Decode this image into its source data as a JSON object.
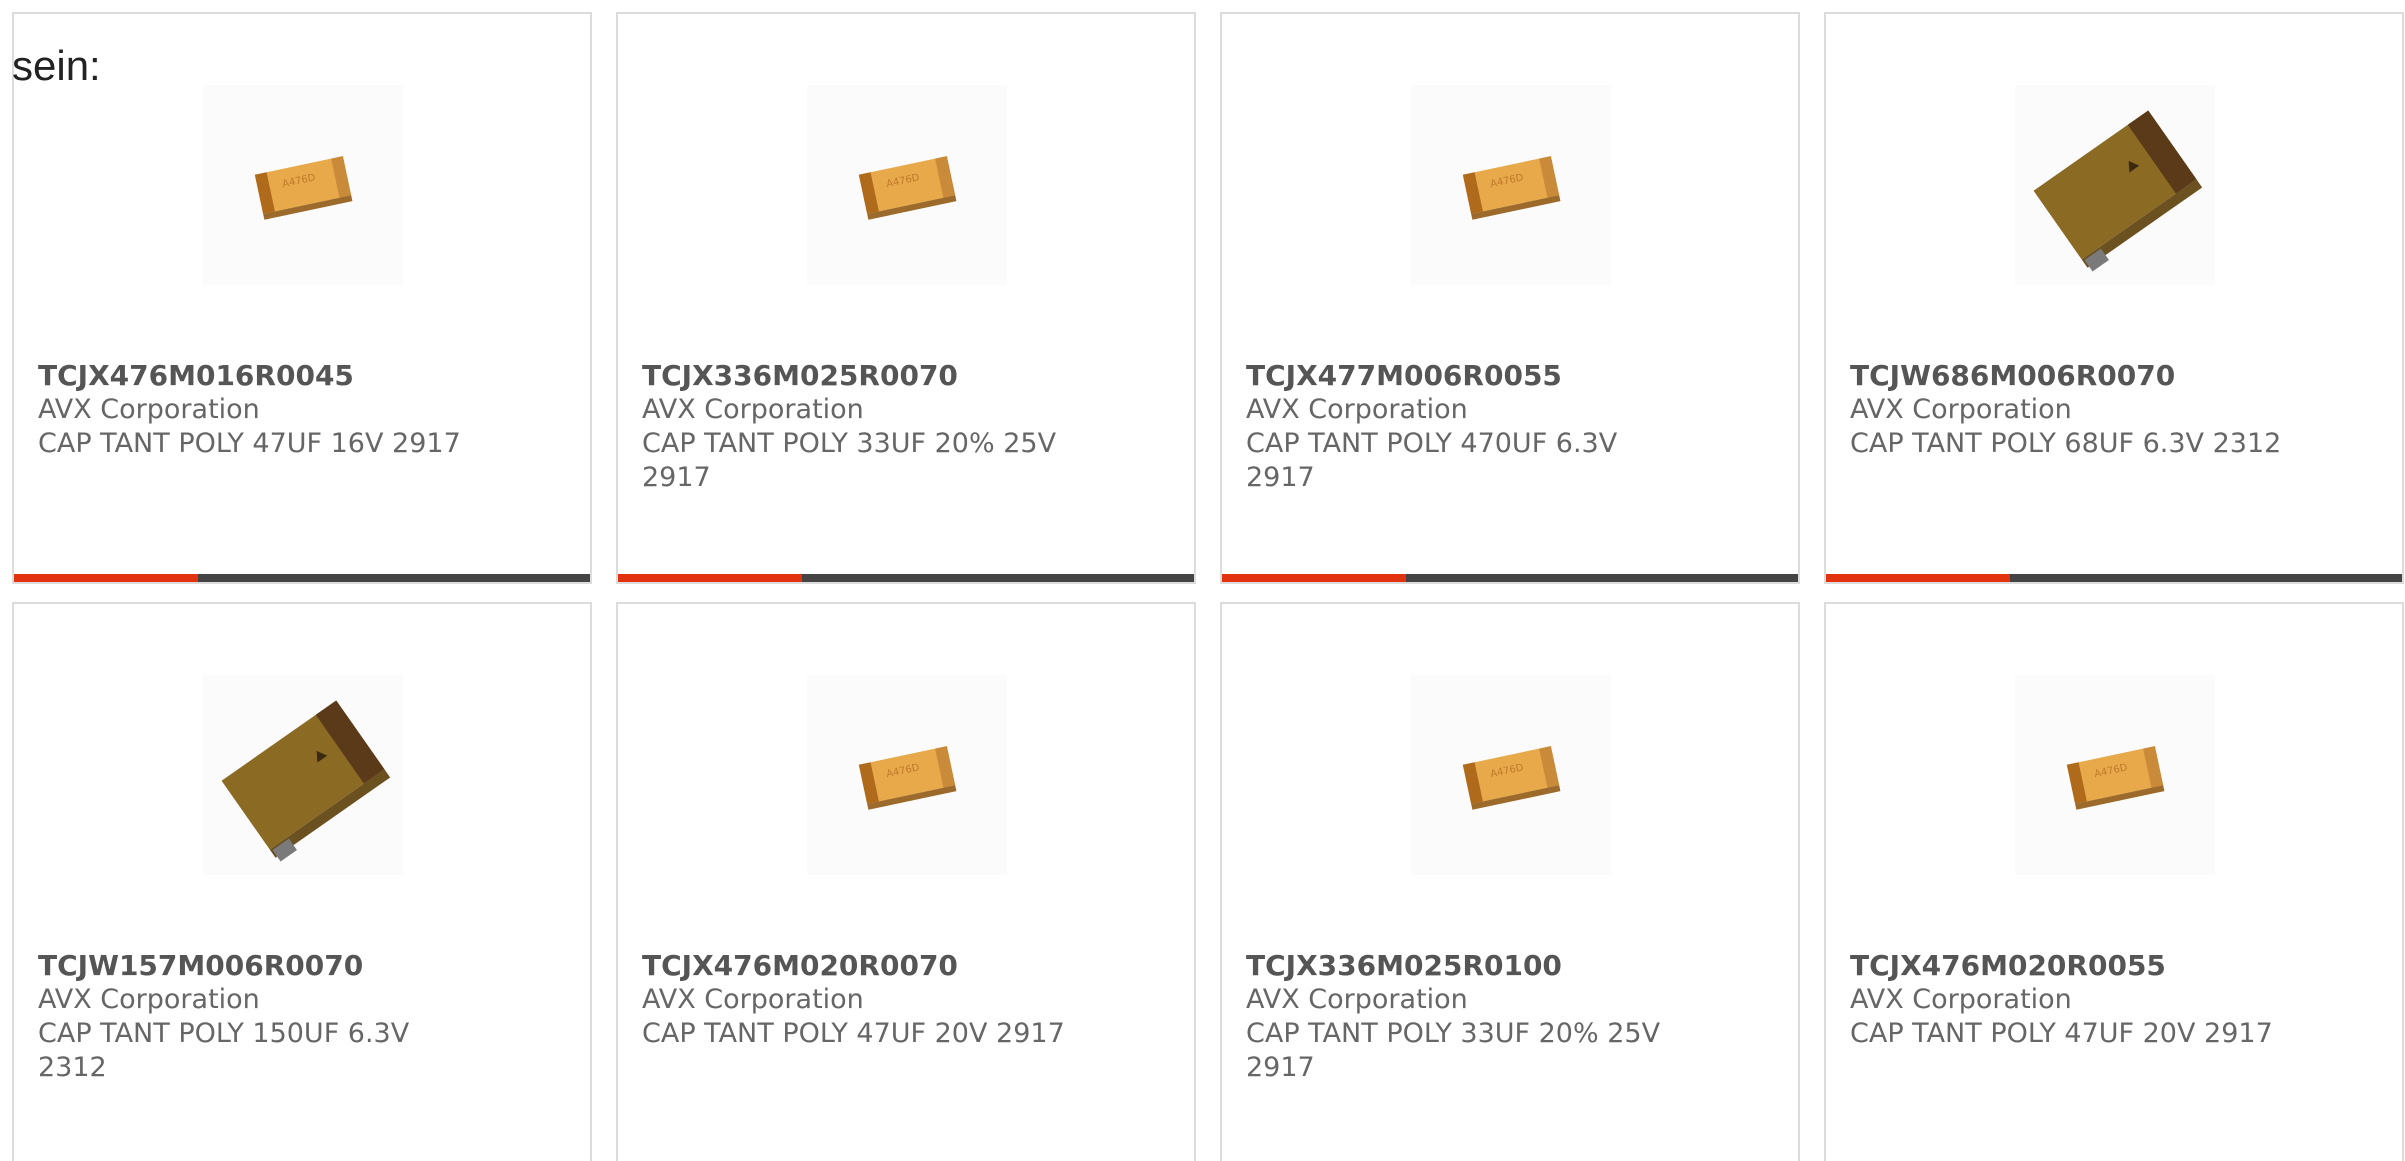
{
  "intro_text": "sein:",
  "accent_color": "#e0330e",
  "products": [
    {
      "part_number": "TCJX476M016R0045",
      "manufacturer": "AVX Corporation",
      "description": "CAP TANT POLY 47UF 16V 2917",
      "image": "small-yellow-capacitor-icon",
      "progress": 0.32
    },
    {
      "part_number": "TCJX336M025R0070",
      "manufacturer": "AVX Corporation",
      "description": "CAP TANT POLY 33UF 20% 25V 2917",
      "image": "small-yellow-capacitor-icon",
      "progress": 0.32
    },
    {
      "part_number": "TCJX477M006R0055",
      "manufacturer": "AVX Corporation",
      "description": "CAP TANT POLY 470UF 6.3V 2917",
      "image": "small-yellow-capacitor-icon",
      "progress": 0.32
    },
    {
      "part_number": "TCJW686M006R0070",
      "manufacturer": "AVX Corporation",
      "description": "CAP TANT POLY 68UF 6.3V 2312",
      "image": "large-brown-capacitor-icon",
      "progress": 0.32
    },
    {
      "part_number": "TCJW157M006R0070",
      "manufacturer": "AVX Corporation",
      "description": "CAP TANT POLY 150UF 6.3V 2312",
      "image": "large-brown-capacitor-icon"
    },
    {
      "part_number": "TCJX476M020R0070",
      "manufacturer": "AVX Corporation",
      "description": "CAP TANT POLY 47UF 20V 2917",
      "image": "small-yellow-capacitor-icon"
    },
    {
      "part_number": "TCJX336M025R0100",
      "manufacturer": "AVX Corporation",
      "description": "CAP TANT POLY 33UF 20% 25V 2917",
      "image": "small-yellow-capacitor-icon"
    },
    {
      "part_number": "TCJX476M020R0055",
      "manufacturer": "AVX Corporation",
      "description": "CAP TANT POLY 47UF 20V 2917",
      "image": "small-yellow-capacitor-icon"
    }
  ]
}
